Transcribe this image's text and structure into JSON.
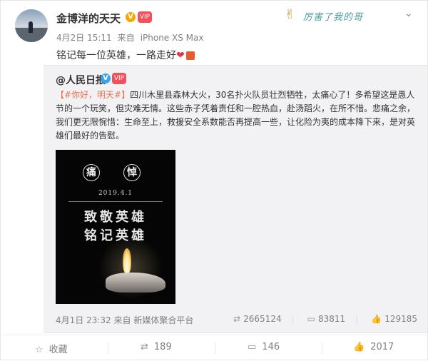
{
  "post": {
    "author": "金博洋的天天",
    "verified_mark": "V",
    "vip_mark": "VIP",
    "date": "4月2日 15:11",
    "source_label": "来自",
    "device": "iPhone XS Max",
    "text": "铭记每一位英雄，一路走好",
    "heart": "❤",
    "banner_text": "厉害了我的哥"
  },
  "repost": {
    "author": "@人民日报",
    "verified_mark": "V",
    "vip_mark": "VIP",
    "hashtag": "【#你好，明天#】",
    "body": "四川木里县森林大火，30名扑火队员壮烈牺牲，太痛心了！多希望这是愚人节的一个玩笑，但灾难无情。这些赤子凭着责任和一腔热血，赴汤蹈火，在所不惜。悲痛之余，我们更无限惋惜：生命至上，救援安全系数能否再提高一些，让化险为夷的成本降下来，是对英雄们最好的告慰。",
    "image": {
      "char1": "痛",
      "char2": "悼",
      "date": "2019.4.1",
      "line1": "致敬英雄",
      "line2": "铭记英雄"
    },
    "date": "4月1日 23:32",
    "source": "来自 新媒体聚合平台",
    "reposts": "2665124",
    "comments": "83811",
    "likes": "129185"
  },
  "toolbar": {
    "favorite": "收藏",
    "repost": "189",
    "comment": "146",
    "like": "2017"
  },
  "icons": {
    "repost": "repost-icon",
    "comment": "comment-icon",
    "like": "thumbs-up-icon",
    "favorite": "star-icon",
    "more": "chevron-down-icon"
  },
  "colors": {
    "hashtag": "#eb7350",
    "repost_bg": "#f2f2f5",
    "verified_orange": "#f8a700",
    "verified_blue": "#36a4f0",
    "vip_red": "#f04f5b"
  }
}
